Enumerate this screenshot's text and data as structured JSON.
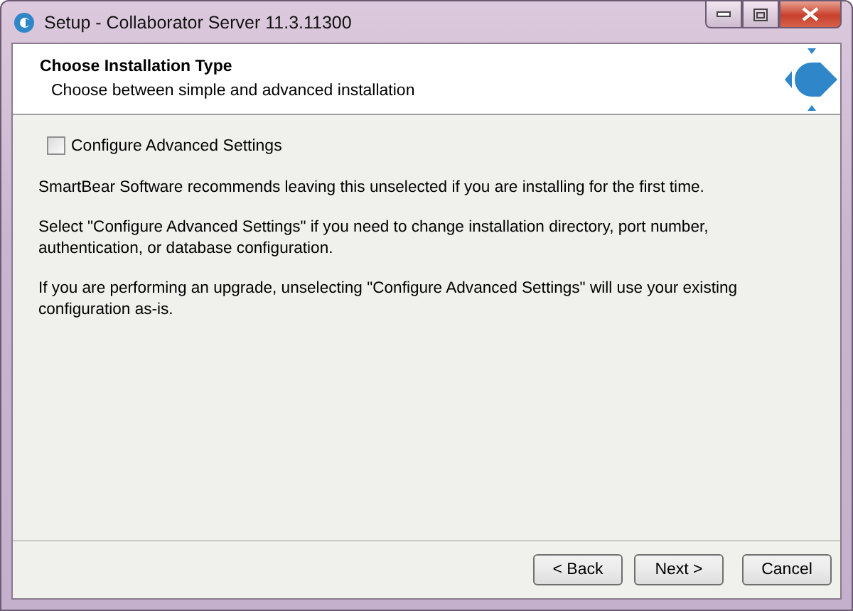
{
  "window": {
    "title": "Setup - Collaborator Server 11.3.11300"
  },
  "header": {
    "title": "Choose Installation Type",
    "subtitle": "Choose between simple and advanced installation"
  },
  "option": {
    "label": "Configure Advanced Settings",
    "checked": false
  },
  "paragraphs": [
    "SmartBear Software recommends leaving this unselected if you are installing for the first time.",
    "Select \"Configure Advanced Settings\" if you need to change installation directory, port number, authentication, or database configuration.",
    "If you are performing an upgrade, unselecting \"Configure Advanced Settings\" will use your existing configuration as-is."
  ],
  "buttons": [
    "< Back",
    "Next >",
    "Cancel"
  ]
}
